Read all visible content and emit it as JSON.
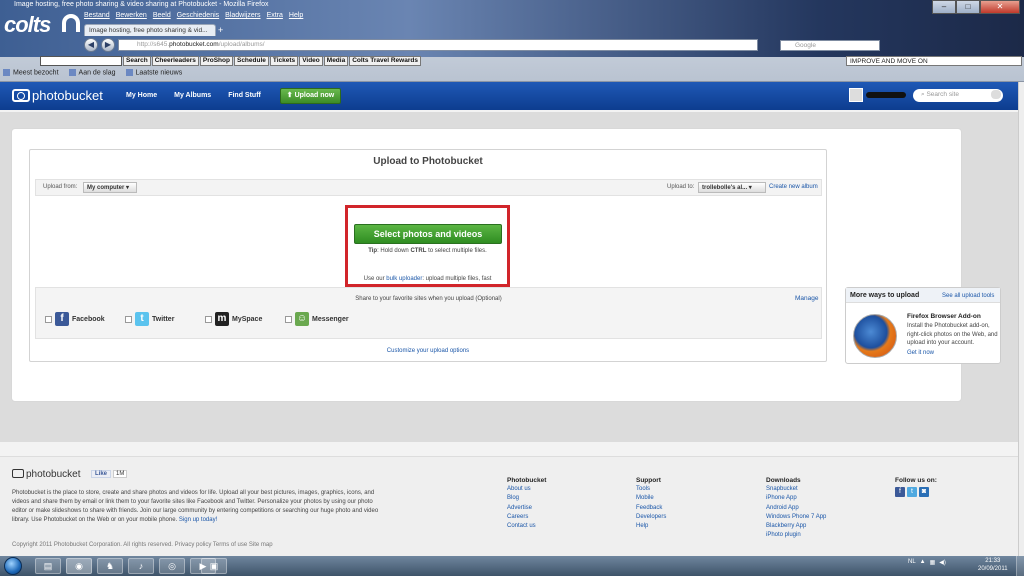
{
  "browser": {
    "window_title": "Image hosting, free photo sharing & video sharing at Photobucket - Mozilla Firefox",
    "theme_logo": "colts",
    "menu": [
      "Bestand",
      "Bewerken",
      "Beeld",
      "Geschiedenis",
      "Bladwijzers",
      "Extra",
      "Help"
    ],
    "tab_label": "Image hosting, free photo sharing & vid...",
    "url_prefix": "http://s645.",
    "url_domain": "photobucket.com",
    "url_path": "/upload/albums/",
    "search_placeholder": "Google",
    "window_controls": {
      "minimize": "–",
      "maximize": "□",
      "close": "✕"
    },
    "colts_toolbar": {
      "search_label": "Search",
      "buttons": [
        "Cheerleaders",
        "ProShop",
        "Schedule",
        "Tickets",
        "Video",
        "Media",
        "Colts Travel Rewards"
      ]
    },
    "improve_text": "IMPROVE AND MOVE ON",
    "bookmarks": [
      "Meest bezocht",
      "Aan de slag",
      "Laatste nieuws"
    ]
  },
  "header": {
    "logo_text": "photobucket",
    "nav": [
      "My Home",
      "My Albums",
      "Find Stuff"
    ],
    "upload_now": "Upload now",
    "search_placeholder": "Search site"
  },
  "upload": {
    "title": "Upload to Photobucket",
    "upload_from_label": "Upload from:",
    "upload_from_value": "My computer",
    "upload_to_label": "Upload to:",
    "upload_to_value": "trollebolle's al...",
    "create_album": "Create new album",
    "select_button": "Select photos and videos",
    "tip_prefix": "Tip",
    "tip_text": ": Hold down ",
    "tip_key": "CTRL",
    "tip_suffix": " to select multiple files.",
    "bulk_prefix": "Use our ",
    "bulk_link": "bulk uploader",
    "bulk_suffix": ": upload multiple files, fast",
    "share_label": "Share to your favorite sites when you upload (Optional)",
    "manage": "Manage",
    "share_sites": [
      "Facebook",
      "Twitter",
      "MySpace",
      "Messenger"
    ],
    "customize": "Customize your upload options"
  },
  "side_box": {
    "title": "More ways to upload",
    "link": "See all upload tools",
    "ff_title": "Firefox Browser Add-on",
    "ff_desc": "Install the Photobucket add-on, right-click photos on the Web, and upload into your account.",
    "ff_get": "Get it now"
  },
  "footer": {
    "logo_text": "photobucket",
    "like_label": "Like",
    "like_count": "1M",
    "description": "Photobucket is the place to store, create and share photos and videos for life. Upload all your best pictures, images, graphics, icons, and videos and share them by email or link them to your favorite sites like Facebook and Twitter. Personalize your photos by using our photo editor or make slideshows to share with friends. Join our large community by entering competitions or searching our huge photo and video library. Use Photobucket on the Web or on your mobile phone.",
    "signup": "Sign up today!",
    "columns": [
      {
        "head": "Photobucket",
        "links": [
          "About us",
          "Blog",
          "Advertise",
          "Careers",
          "Contact us"
        ]
      },
      {
        "head": "Support",
        "links": [
          "Tools",
          "Mobile",
          "Feedback",
          "Developers",
          "Help"
        ]
      },
      {
        "head": "Downloads",
        "links": [
          "Snapbucket",
          "iPhone App",
          "Android App",
          "Windows Phone 7 App",
          "Blackberry App",
          "iPhoto plugin"
        ]
      }
    ],
    "follow_head": "Follow us on:",
    "copyright": "Copyright 2011 Photobucket Corporation. All rights reserved.   Privacy policy   Terms of use   Site map"
  },
  "taskbar": {
    "language": "NL",
    "time": "21:33",
    "date": "20/09/2011"
  }
}
